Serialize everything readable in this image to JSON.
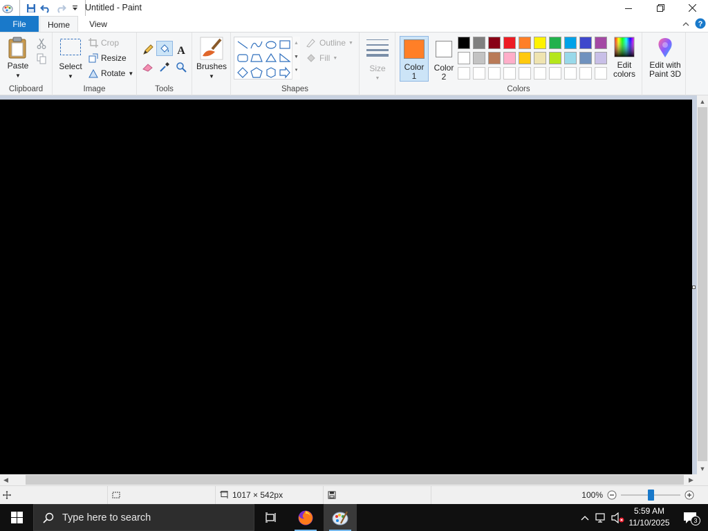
{
  "window": {
    "title": "Untitled - Paint"
  },
  "tabs": [
    {
      "label": "File"
    },
    {
      "label": "Home"
    },
    {
      "label": "View"
    }
  ],
  "ribbon": {
    "clipboard": {
      "group_label": "Clipboard",
      "paste": "Paste"
    },
    "image": {
      "group_label": "Image",
      "select": "Select",
      "crop": "Crop",
      "resize": "Resize",
      "rotate": "Rotate"
    },
    "tools": {
      "group_label": "Tools"
    },
    "brushes": {
      "label": "Brushes"
    },
    "shapes": {
      "group_label": "Shapes",
      "outline": "Outline",
      "fill": "Fill"
    },
    "size": {
      "label": "Size"
    },
    "color1": {
      "label_line1": "Color",
      "label_line2": "1",
      "color": "#ff7f27"
    },
    "color2": {
      "label_line1": "Color",
      "label_line2": "2",
      "color": "#ffffff"
    },
    "colors": {
      "group_label": "Colors",
      "row1": [
        "#000000",
        "#7f7f7f",
        "#880015",
        "#ed1c24",
        "#ff7f27",
        "#fff200",
        "#22b14c",
        "#00a2e8",
        "#3f48cc",
        "#a349a4"
      ],
      "row2": [
        "#ffffff",
        "#c3c3c3",
        "#b97a57",
        "#ffaec9",
        "#ffc90e",
        "#efe4b0",
        "#b5e61d",
        "#99d9ea",
        "#7092be",
        "#c8bfe7"
      ],
      "row3_count": 10
    },
    "edit_colors": {
      "line1": "Edit",
      "line2": "colors"
    },
    "paint3d": {
      "line1": "Edit with",
      "line2": "Paint 3D"
    }
  },
  "status": {
    "canvas_size": "1017 × 542px",
    "zoom": "100%",
    "zoom_level": 1.0
  },
  "taskbar": {
    "search_placeholder": "Type here to search",
    "time": "5:59 AM",
    "date": "11/10/2025",
    "notification_count": "3"
  },
  "colors": {
    "accent": "#1979ca",
    "canvas": "#000000",
    "workspace": "#c8d1e0"
  }
}
